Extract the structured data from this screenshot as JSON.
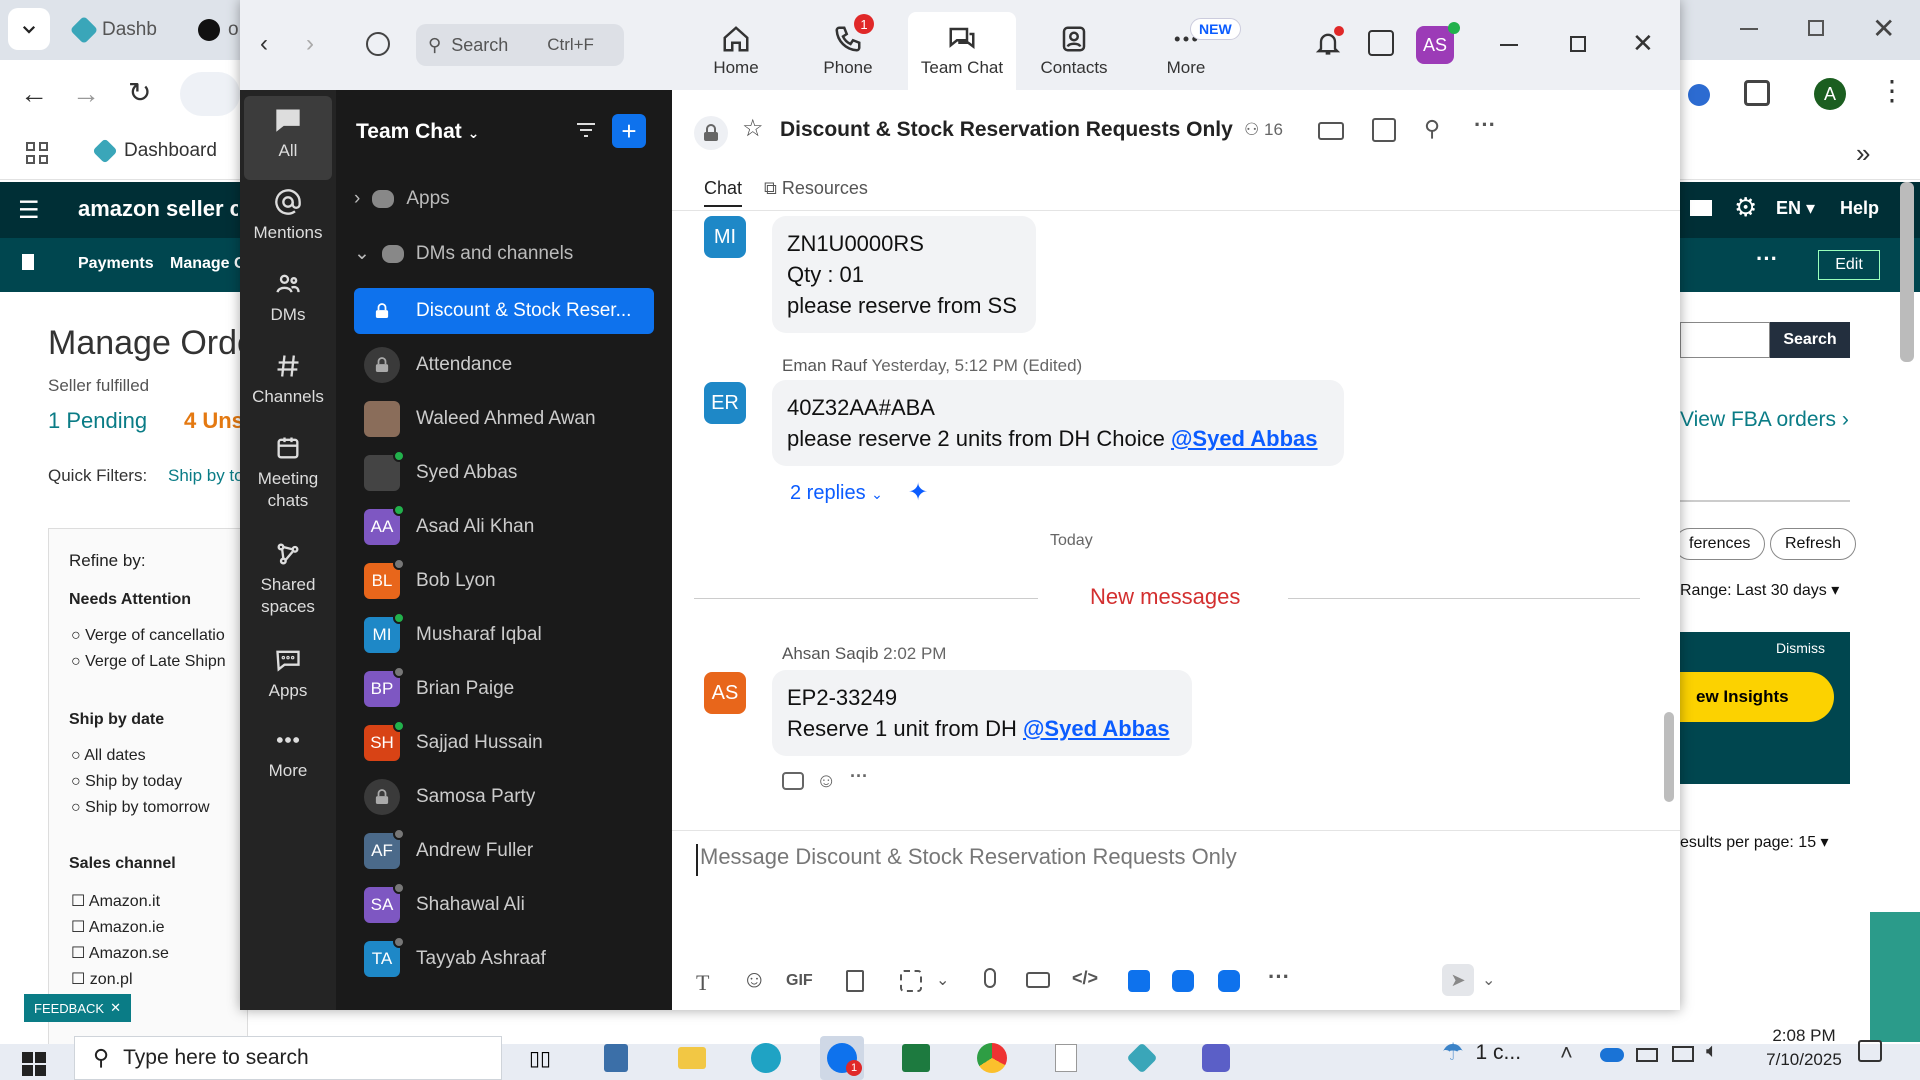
{
  "browser": {
    "tabs": [
      "Dashb",
      "o"
    ],
    "bookmark": "Dashboard",
    "profile_initial": "A",
    "amazon": {
      "logo": "amazon seller centr",
      "lang": "EN",
      "help": "Help",
      "nav": [
        "Payments",
        "Manage C"
      ],
      "edit": "Edit",
      "page_title": "Manage Orde",
      "subtitle": "Seller fulfilled",
      "tab_pending": "1 Pending",
      "tab_unshipped": "4 Uns",
      "quick_filters": "Quick Filters:",
      "quick_filter_link": "Ship by to",
      "refine_by": "Refine by:",
      "needs_attention": "Needs Attention",
      "attention_opts": [
        "Verge of cancellatio",
        "Verge of Late Shipn"
      ],
      "ship_by_date": "Ship by date",
      "ship_opts": [
        "All dates",
        "Ship by today",
        "Ship by tomorrow"
      ],
      "sales_channel": "Sales channel",
      "channels": [
        "Amazon.it",
        "Amazon.ie",
        "Amazon.se",
        "zon.pl"
      ],
      "search_btn": "Search",
      "view_fba": "View FBA orders ›",
      "preferences_btn": "ferences",
      "refresh_btn": "Refresh",
      "date_range": "Range: Last 30 days",
      "dismiss": "Dismiss",
      "insights_btn": "ew Insights",
      "results_per_page": "esults per page: 15",
      "feedback": "FEEDBACK"
    }
  },
  "zoom": {
    "search_placeholder": "Search",
    "search_shortcut": "Ctrl+F",
    "tabs": [
      {
        "label": "Home",
        "icon": "home-icon"
      },
      {
        "label": "Phone",
        "icon": "phone-icon",
        "badge": "1"
      },
      {
        "label": "Team Chat",
        "icon": "chat-icon"
      },
      {
        "label": "Contacts",
        "icon": "contacts-icon"
      },
      {
        "label": "More",
        "icon": "more-icon",
        "badge": "NEW"
      }
    ],
    "user_initials": "AS",
    "rail": [
      "All",
      "Mentions",
      "DMs",
      "Channels",
      "Meeting chats",
      "Shared spaces",
      "Apps",
      "More"
    ],
    "sidebar_title": "Team Chat",
    "sections": [
      "Apps",
      "DMs and channels"
    ],
    "channels": [
      {
        "name": "Discount & Stock Reser...",
        "initials": "",
        "color": "#0e72ed",
        "type": "lock"
      },
      {
        "name": "Attendance",
        "initials": "",
        "color": "#3a3a3a",
        "type": "lock"
      },
      {
        "name": "Waleed Ahmed Awan",
        "initials": "",
        "color": "#8a6d5a",
        "type": "photo"
      },
      {
        "name": "Syed Abbas",
        "initials": "",
        "color": "#444",
        "type": "photo",
        "status": "#22b14c"
      },
      {
        "name": "Asad Ali Khan",
        "initials": "AA",
        "color": "#7e57c2",
        "status": "#22b14c"
      },
      {
        "name": "Bob Lyon",
        "initials": "BL",
        "color": "#e8661b",
        "status": "#777"
      },
      {
        "name": "Musharaf Iqbal",
        "initials": "MI",
        "color": "#1e88c7",
        "status": "#22b14c"
      },
      {
        "name": "Brian Paige",
        "initials": "BP",
        "color": "#7e57c2",
        "status": "#777"
      },
      {
        "name": "Sajjad Hussain",
        "initials": "SH",
        "color": "#d84315",
        "status": "#22b14c"
      },
      {
        "name": "Samosa Party",
        "initials": "",
        "color": "#3a3a3a",
        "type": "lock"
      },
      {
        "name": "Andrew Fuller",
        "initials": "AF",
        "color": "#4b6a8a",
        "status": "#777"
      },
      {
        "name": "Shahawal Ali",
        "initials": "SA",
        "color": "#7e57c2",
        "status": "#777"
      },
      {
        "name": "Tayyab Ashraaf",
        "initials": "TA",
        "color": "#1e88c7",
        "status": "#777"
      }
    ],
    "channel_title": "Discount & Stock Reservation Requests Only",
    "member_count": "16",
    "channel_tabs": [
      "Chat",
      "Resources"
    ],
    "messages": [
      {
        "initials": "MI",
        "color": "#1e88c7",
        "lines": [
          "ZN1U0000RS",
          "Qty : 01",
          "please reserve from SS"
        ]
      },
      {
        "initials": "ER",
        "color": "#1e88c7",
        "author": "Eman Rauf",
        "time": "Yesterday, 5:12 PM (Edited)",
        "lines": [
          "40Z32AA#ABA",
          "please reserve 2 units from DH Choice"
        ],
        "mention": "@Syed Abbas",
        "replies": "2 replies"
      },
      {
        "initials": "AS",
        "color": "#e8661b",
        "author": "Ahsan Saqib",
        "time": "2:02 PM",
        "lines": [
          "EP2-33249",
          "Reserve 1 unit from DH"
        ],
        "mention": "@Syed Abbas"
      }
    ],
    "today_label": "Today",
    "new_messages": "New messages",
    "composer_placeholder": "Message Discount & Stock Reservation Requests Only",
    "gif_label": "GIF"
  },
  "taskbar": {
    "search_placeholder": "Type here to search",
    "weather": "1 c...",
    "time": "2:08 PM",
    "date": "7/10/2025",
    "zoom_badge": "1"
  }
}
